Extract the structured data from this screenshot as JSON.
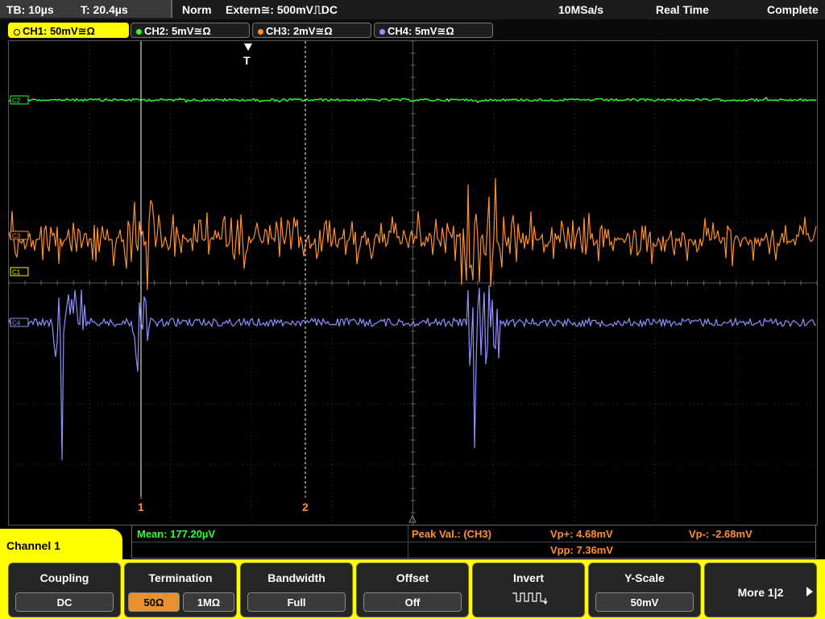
{
  "status": {
    "timebase": "TB: 10µs",
    "trigger_time": "T: 20.4µs",
    "trigger_mode": "Norm",
    "trigger_source": "Extern≅: 500mV⎍DC",
    "sample_rate": "10MSa/s",
    "acq_mode": "Real Time",
    "acq_state": "Complete"
  },
  "channels": [
    {
      "label": "CH1: 50mV≅Ω",
      "color": "#ffff00",
      "active": true
    },
    {
      "label": "CH2: 5mV≅Ω",
      "color": "#30ff30",
      "active": false
    },
    {
      "label": "CH3: 2mV≅Ω",
      "color": "#ff9030",
      "active": false
    },
    {
      "label": "CH4: 5mV≅Ω",
      "color": "#9090ff",
      "active": false
    }
  ],
  "markers": {
    "trigger": "T",
    "ch1": "C1",
    "ch2": "C2",
    "ch3": "C3",
    "ch4": "C4",
    "cursor1": "1",
    "cursor2": "2"
  },
  "measurements": {
    "mean": "Mean: 177.20µV",
    "peak_label": "Peak Val.: (CH3)",
    "vp_plus": "Vp+: 4.68mV",
    "vp_minus": "Vp-: -2.68mV",
    "vpp": "Vpp: 7.36mV"
  },
  "menu": {
    "title": "Channel 1",
    "coupling": {
      "label": "Coupling",
      "value": "DC"
    },
    "termination": {
      "label": "Termination",
      "opt_a": "50Ω",
      "opt_b": "1MΩ",
      "selected": "50Ω"
    },
    "bandwidth": {
      "label": "Bandwidth",
      "value": "Full"
    },
    "offset": {
      "label": "Offset",
      "value": "Off"
    },
    "invert": {
      "label": "Invert"
    },
    "yscale": {
      "label": "Y-Scale",
      "value": "50mV"
    },
    "more": {
      "label": "More 1|2"
    }
  },
  "colors": {
    "ch1": "#ffff00",
    "ch2": "#30ff30",
    "ch3": "#ff9030",
    "ch4": "#9090ff",
    "meas_green": "#30ff30",
    "meas_orange": "#ff9030"
  }
}
